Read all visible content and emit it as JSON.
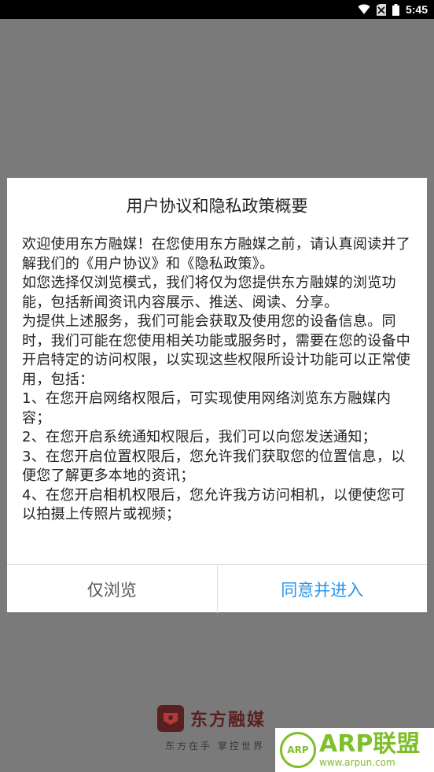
{
  "status_bar": {
    "time": "5:45",
    "icons": [
      "wifi-icon",
      "no-sim-icon",
      "battery-icon"
    ]
  },
  "dialog": {
    "title": "用户协议和隐私政策概要",
    "paragraphs": [
      "欢迎使用东方融媒！在您使用东方融媒之前，请认真阅读并了解我们的《用户协议》和《隐私政策》。",
      "如您选择仅浏览模式，我们将仅为您提供东方融媒的浏览功能，包括新闻资讯内容展示、推送、阅读、分享。",
      "为提供上述服务，我们可能会获取及使用您的设备信息。同时，我们可能在您使用相关功能或服务时，需要在您的设备中开启特定的访问权限，以实现这些权限所设计功能可以正常使用，包括：",
      "1、在您开启网络权限后，可实现使用网络浏览东方融媒内容；",
      "2、在您开启系统通知权限后，我们可以向您发送通知；",
      "3、在您开启位置权限后，您允许我们获取您的位置信息，以便您了解更多本地的资讯；",
      "4、在您开启相机权限后，您允许我方访问相机，以便使您可以拍摄上传照片或视频；"
    ],
    "browse_only_label": "仅浏览",
    "agree_label": "同意并进入"
  },
  "splash": {
    "brand_name": "东方融媒",
    "slogan": "东方在手 掌控世界"
  },
  "watermark": {
    "title": "ARP联盟",
    "url": "www.arpun.com",
    "badge": "ARP"
  },
  "colors": {
    "overlay": "#7a7a7a",
    "accent": "#2a95e8",
    "watermark_green": "#7fbf2a"
  }
}
